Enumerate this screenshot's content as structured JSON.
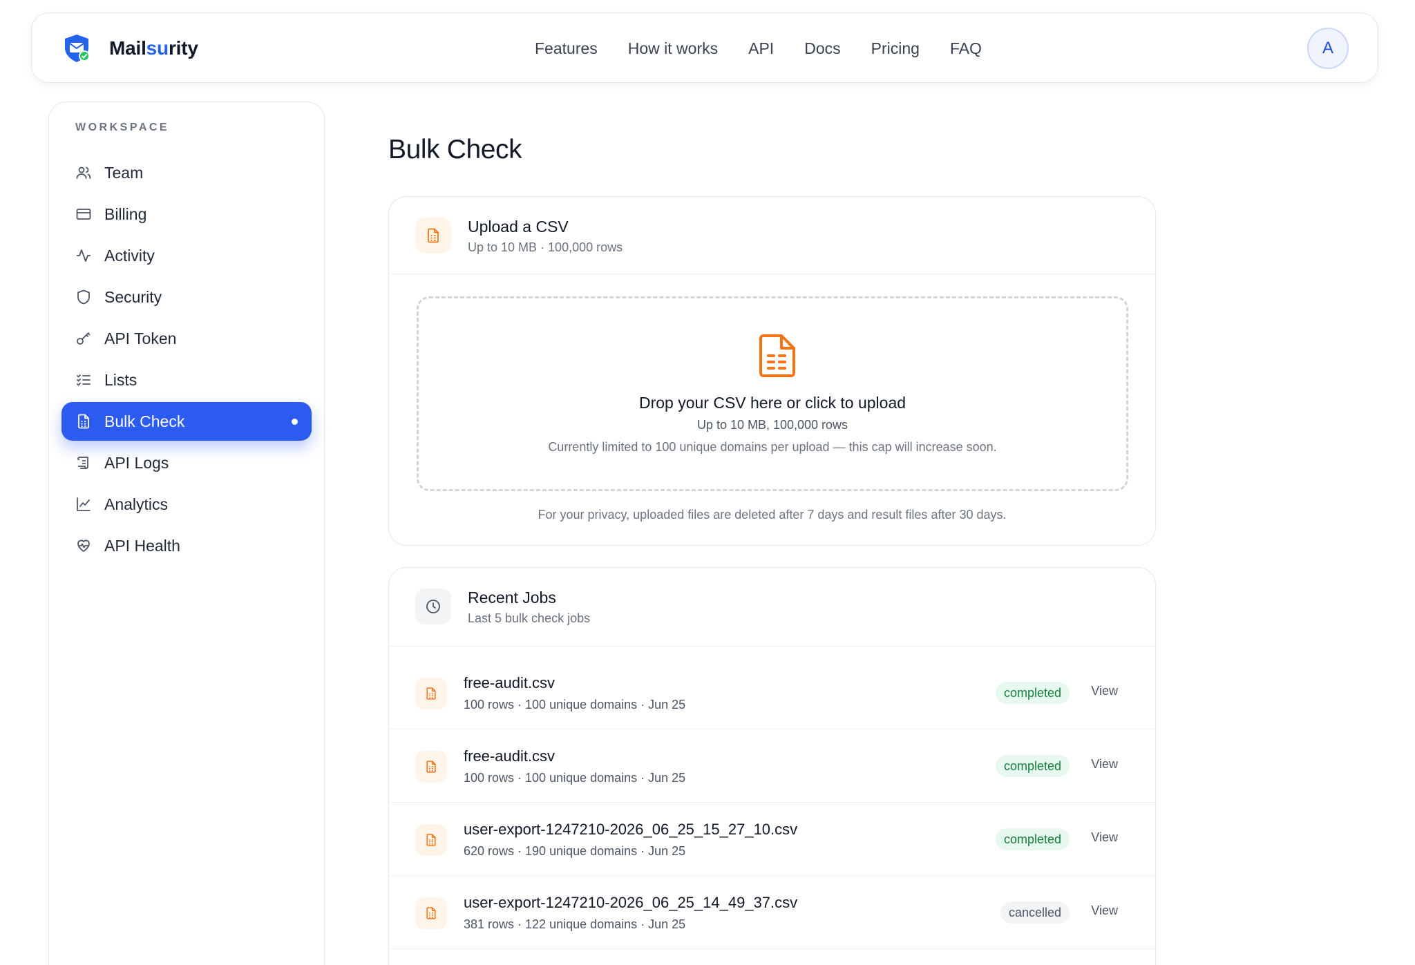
{
  "brand": {
    "name_prefix": "Mail",
    "name_accent": "su",
    "name_suffix": "rity",
    "accent_color": "#2563eb"
  },
  "topnav": [
    {
      "label": "Features"
    },
    {
      "label": "How it works"
    },
    {
      "label": "API"
    },
    {
      "label": "Docs"
    },
    {
      "label": "Pricing"
    },
    {
      "label": "FAQ"
    }
  ],
  "user": {
    "avatar_initial": "A"
  },
  "sidebar": {
    "section_label": "WORKSPACE",
    "items": [
      {
        "label": "Team",
        "icon": "users-icon"
      },
      {
        "label": "Billing",
        "icon": "credit-card-icon"
      },
      {
        "label": "Activity",
        "icon": "activity-icon"
      },
      {
        "label": "Security",
        "icon": "shield-icon"
      },
      {
        "label": "API Token",
        "icon": "key-icon"
      },
      {
        "label": "Lists",
        "icon": "list-checks-icon"
      },
      {
        "label": "Bulk Check",
        "icon": "file-spreadsheet-icon",
        "active": true
      },
      {
        "label": "API Logs",
        "icon": "scroll-icon"
      },
      {
        "label": "Analytics",
        "icon": "line-chart-icon"
      },
      {
        "label": "API Health",
        "icon": "heart-pulse-icon"
      }
    ]
  },
  "main": {
    "title": "Bulk Check",
    "upload": {
      "title": "Upload a CSV",
      "subtitle": "Up to 10 MB · 100,000 rows",
      "drop_title": "Drop your CSV here or click to upload",
      "drop_sub": "Up to 10 MB, 100,000 rows",
      "drop_note": "Currently limited to 100 unique domains per upload — this cap will increase soon.",
      "privacy_note": "For your privacy, uploaded files are deleted after 7 days and result files after 30 days."
    },
    "recent": {
      "title": "Recent Jobs",
      "subtitle": "Last 5 bulk check jobs",
      "view_label": "View",
      "jobs": [
        {
          "name": "free-audit.csv",
          "meta": "100 rows · 100 unique domains · Jun 25",
          "status": "completed"
        },
        {
          "name": "free-audit.csv",
          "meta": "100 rows · 100 unique domains · Jun 25",
          "status": "completed"
        },
        {
          "name": "user-export-1247210-2026_06_25_15_27_10.csv",
          "meta": "620 rows · 190 unique domains · Jun 25",
          "status": "completed"
        },
        {
          "name": "user-export-1247210-2026_06_25_14_49_37.csv",
          "meta": "381 rows · 122 unique domains · Jun 25",
          "status": "cancelled"
        }
      ]
    }
  },
  "colors": {
    "primary": "#2c5bf0",
    "file_icon": "#f97316",
    "status_completed": "#15803d",
    "status_cancelled": "#4b5563"
  }
}
